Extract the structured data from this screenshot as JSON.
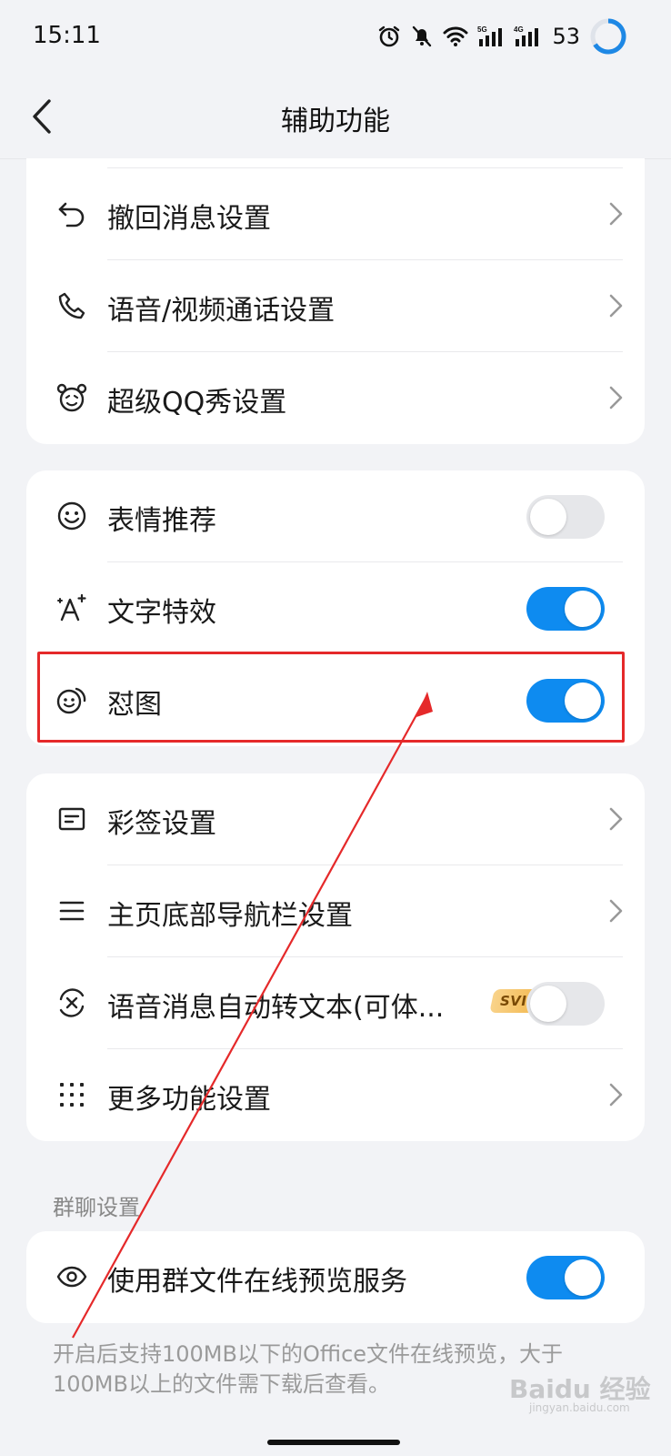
{
  "status_bar": {
    "time": "15:11",
    "battery": "53"
  },
  "nav": {
    "title": "辅助功能"
  },
  "card1": {
    "items": [
      {
        "label": "撤回消息设置",
        "icon": "undo-icon"
      },
      {
        "label": "语音/视频通话设置",
        "icon": "phone-icon"
      },
      {
        "label": "超级QQ秀设置",
        "icon": "bear-face-icon"
      }
    ]
  },
  "card2": {
    "items": [
      {
        "label": "表情推荐",
        "icon": "smiley-icon",
        "toggle": false
      },
      {
        "label": "文字特效",
        "icon": "text-sparkle-icon",
        "toggle": true
      },
      {
        "label": "怼图",
        "icon": "sticker-face-icon",
        "toggle": true
      }
    ]
  },
  "card3": {
    "items": [
      {
        "label": "彩签设置",
        "icon": "tag-card-icon"
      },
      {
        "label": "主页底部导航栏设置",
        "icon": "menu-lines-icon"
      },
      {
        "label": "语音消息自动转文本(可体...",
        "icon": "voice-convert-icon",
        "badge": "SVIP",
        "toggle": false
      },
      {
        "label": "更多功能设置",
        "icon": "grid-dots-icon"
      }
    ]
  },
  "group_section": {
    "header": "群聊设置",
    "items": [
      {
        "label": "使用群文件在线预览服务",
        "icon": "eye-icon",
        "toggle": true
      }
    ],
    "footnote": "开启后支持100MB以下的Office文件在线预览，大于100MB以上的文件需下载后查看。"
  },
  "colors": {
    "accent": "#0e8bf0",
    "annotation": "#e5292a",
    "background": "#f2f3f6"
  },
  "watermark": {
    "text": "Baidu 经验",
    "sub": "jingyan.baidu.com"
  }
}
